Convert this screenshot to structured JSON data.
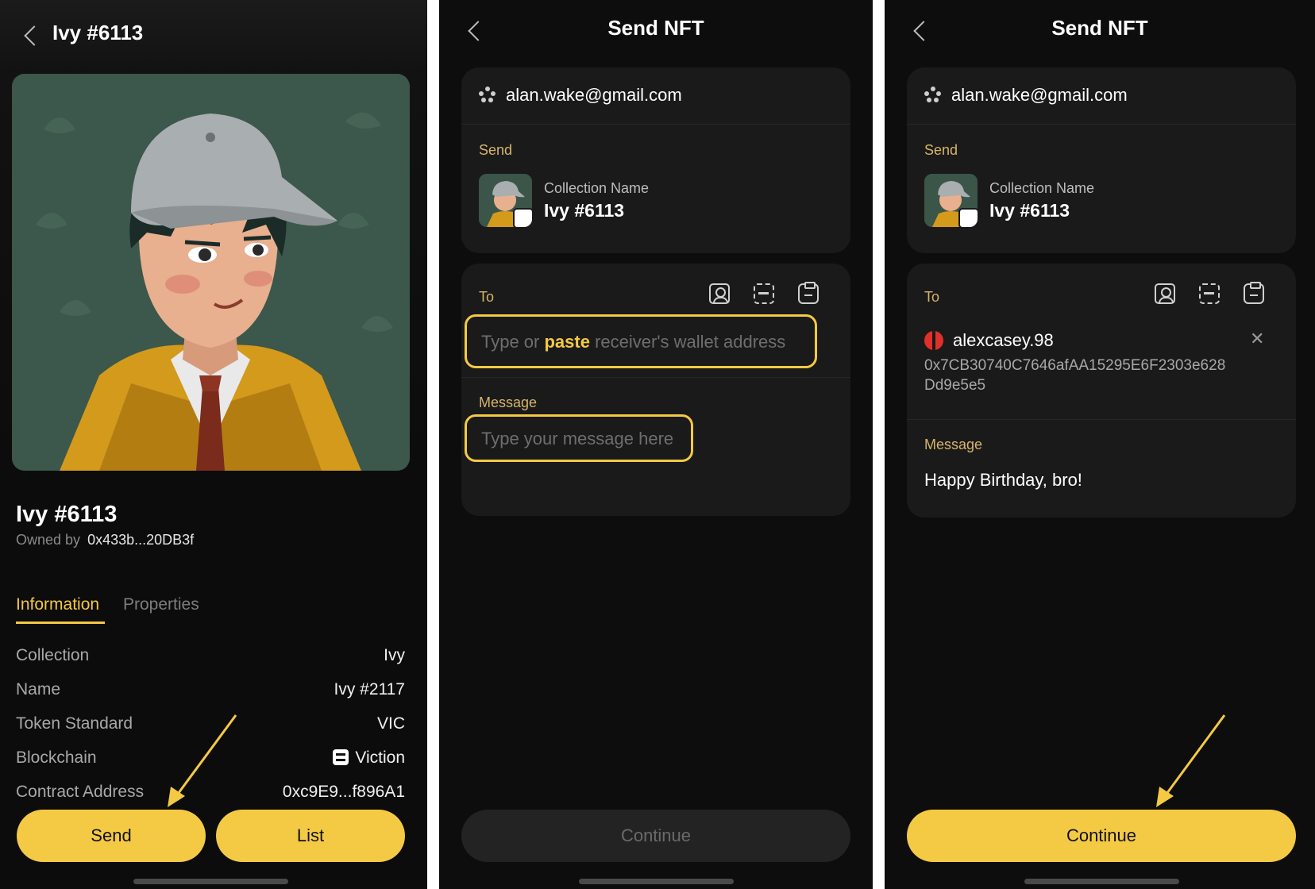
{
  "screen1": {
    "header_title": "Ivy #6113",
    "nft_name": "Ivy #6113",
    "owned_by_label": "Owned by",
    "owner_address": "0x433b...20DB3f",
    "tabs": [
      {
        "label": "Information",
        "active": true
      },
      {
        "label": "Properties",
        "active": false
      }
    ],
    "info_rows": [
      {
        "label": "Collection",
        "value": "Ivy"
      },
      {
        "label": "Name",
        "value": "Ivy #2117"
      },
      {
        "label": "Token Standard",
        "value": "VIC"
      },
      {
        "label": "Blockchain",
        "value": "Viction"
      },
      {
        "label": "Contract Address",
        "value": "0xc9E9...f896A1"
      }
    ],
    "send_button": "Send",
    "list_button": "List"
  },
  "screen2": {
    "header_title": "Send NFT",
    "account": "alan.wake@gmail.com",
    "send_label": "Send",
    "collection_label": "Collection Name",
    "collection_name": "Ivy #6113",
    "to_label": "To",
    "address_placeholder_pre": "Type or ",
    "address_placeholder_highlight": "paste",
    "address_placeholder_post": " receiver's wallet address",
    "message_label": "Message",
    "message_placeholder": "Type your message here",
    "continue_button": "Continue",
    "continue_enabled": false
  },
  "screen3": {
    "header_title": "Send NFT",
    "account": "alan.wake@gmail.com",
    "send_label": "Send",
    "collection_label": "Collection Name",
    "collection_name": "Ivy #6113",
    "to_label": "To",
    "recipient_name": "alexcasey.98",
    "recipient_address_line1": "0x7CB30740C7646afAA15295E6F2303e628",
    "recipient_address_line2": "Dd9e5e5",
    "message_label": "Message",
    "message_value": "Happy Birthday, bro!",
    "continue_button": "Continue",
    "continue_enabled": true
  },
  "colors": {
    "accent": "#f4c944",
    "background": "#0d0d0d",
    "card": "#1a1a1a",
    "gold_label": "#d7b46a"
  },
  "icons": [
    "back-chevron-icon",
    "account-icon",
    "contact-book-icon",
    "scan-icon",
    "clipboard-icon",
    "close-icon",
    "viction-chain-icon",
    "pointer-arrow-icon"
  ]
}
